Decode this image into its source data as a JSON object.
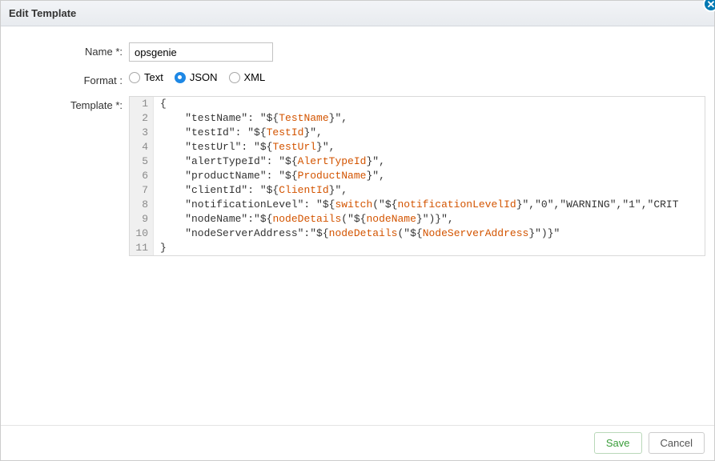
{
  "header": {
    "title": "Edit Template"
  },
  "labels": {
    "name": "Name *:",
    "format": "Format :",
    "template": "Template *:"
  },
  "name_value": "opsgenie",
  "format_options": {
    "text": "Text",
    "json": "JSON",
    "xml": "XML",
    "selected": "json"
  },
  "code_lines": [
    [
      {
        "t": "{"
      }
    ],
    [
      {
        "t": "    \"testName\": \"${"
      },
      {
        "t": "TestName",
        "c": "kw"
      },
      {
        "t": "}\","
      }
    ],
    [
      {
        "t": "    \"testId\": \"${"
      },
      {
        "t": "TestId",
        "c": "kw"
      },
      {
        "t": "}\","
      }
    ],
    [
      {
        "t": "    \"testUrl\": \"${"
      },
      {
        "t": "TestUrl",
        "c": "kw"
      },
      {
        "t": "}\","
      }
    ],
    [
      {
        "t": "    \"alertTypeId\": \"${"
      },
      {
        "t": "AlertTypeId",
        "c": "kw"
      },
      {
        "t": "}\","
      }
    ],
    [
      {
        "t": "    \"productName\": \"${"
      },
      {
        "t": "ProductName",
        "c": "kw"
      },
      {
        "t": "}\","
      }
    ],
    [
      {
        "t": "    \"clientId\": \"${"
      },
      {
        "t": "ClientId",
        "c": "kw"
      },
      {
        "t": "}\","
      }
    ],
    [
      {
        "t": "    \"notificationLevel\": \"${"
      },
      {
        "t": "switch",
        "c": "kw"
      },
      {
        "t": "(\"${"
      },
      {
        "t": "notificationLevelId",
        "c": "kw"
      },
      {
        "t": "}\",\"0\",\"WARNING\",\"1\",\"CRIT"
      }
    ],
    [
      {
        "t": "    \"nodeName\":\"${"
      },
      {
        "t": "nodeDetails",
        "c": "kw"
      },
      {
        "t": "(\"${"
      },
      {
        "t": "nodeName",
        "c": "kw"
      },
      {
        "t": "}\")}\","
      }
    ],
    [
      {
        "t": "    \"nodeServerAddress\":\"${"
      },
      {
        "t": "nodeDetails",
        "c": "kw"
      },
      {
        "t": "(\"${"
      },
      {
        "t": "NodeServerAddress",
        "c": "kw"
      },
      {
        "t": "}\")}\""
      }
    ],
    [
      {
        "t": "}"
      }
    ]
  ],
  "footer": {
    "save": "Save",
    "cancel": "Cancel"
  }
}
